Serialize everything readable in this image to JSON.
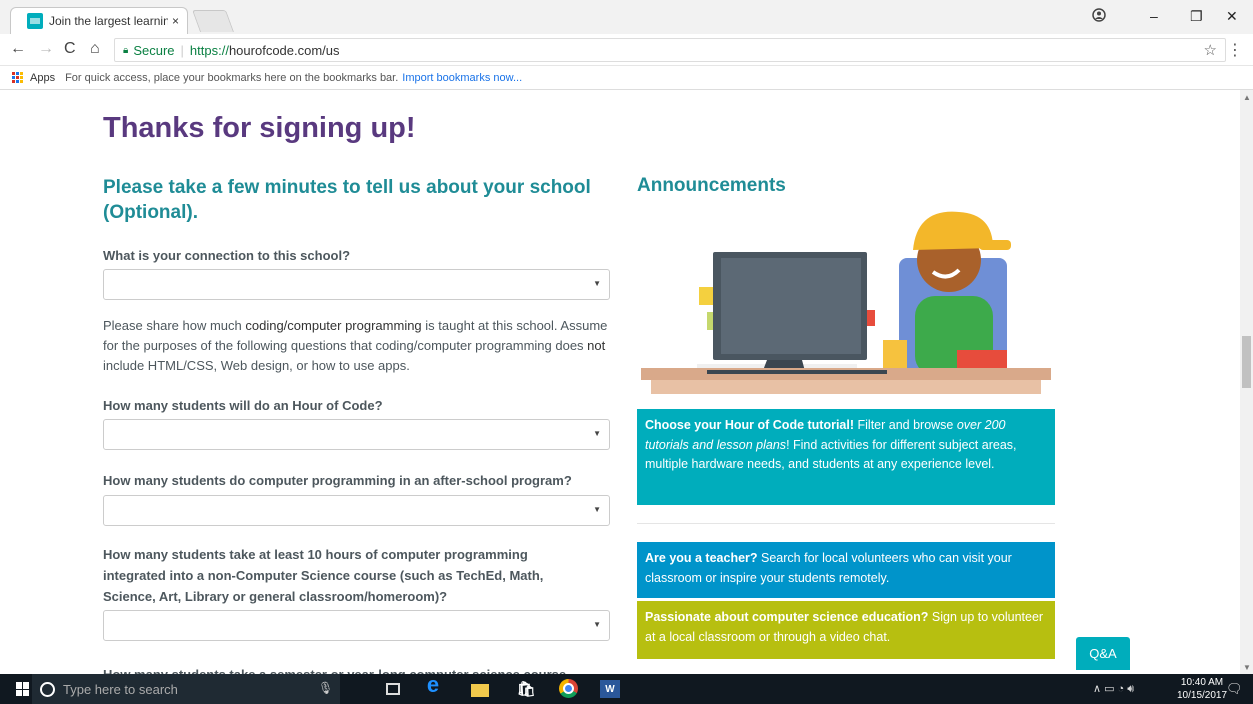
{
  "browser": {
    "tab_title": "Join the largest learning",
    "tab_close": "×",
    "profile_icon": "person-circle-icon",
    "win_minimize": "–",
    "win_restore": "❐",
    "win_close": "✕"
  },
  "toolbar": {
    "back": "←",
    "forward": "→",
    "reload": "C",
    "home": "⌂",
    "secure_label": "Secure",
    "url_scheme": "https://",
    "url_rest": "hourofcode.com/us",
    "star": "☆",
    "menu": "⋮"
  },
  "bookmarks": {
    "apps_label": "Apps",
    "hint": "For quick access, place your bookmarks here on the bookmarks bar.",
    "import_link": "Import bookmarks now..."
  },
  "page": {
    "title": "Thanks for signing up!",
    "survey_heading": "Please take a few minutes to tell us about your school (Optional).",
    "announcements_heading": "Announcements",
    "q1": "What is your connection to this school?",
    "para_before": "Please share how much ",
    "para_mid1": "coding/computer programming",
    "para_mid2": " is taught at this school. Assume for the purposes of the following questions that coding/computer programming does ",
    "para_not": "not",
    "para_end": " include HTML/CSS, Web design, or how to use apps.",
    "q2": "How many students will do an Hour of Code?",
    "q3": "How many students do computer programming in an after-school program?",
    "q4": "How many students take at least 10 hours of computer programming integrated into a non-Computer Science course (such as TechEd, Math, Science, Art, Library or general classroom/homeroom)?",
    "q5": "How many students take a semester or year-long computer science course",
    "select_caret": "▼"
  },
  "cards": {
    "teal_bold": "Choose your Hour of Code tutorial!",
    "teal_text1": " Filter and browse ",
    "teal_italic": "over 200 tutorials and lesson plans",
    "teal_text2": "! Find activities for different subject areas, multiple hardware needs, and students at any experience level.",
    "blue_bold": "Are you a teacher?",
    "blue_text": " Search for local volunteers who can visit your classroom or inspire your students remotely.",
    "green_bold": "Passionate about computer science education?",
    "green_text": " Sign up to volunteer at a local classroom or through a video chat."
  },
  "qa_button": "Q&A",
  "taskbar": {
    "search_placeholder": "Type here to search",
    "word_label": "W",
    "time": "10:40 AM",
    "date": "10/15/2017"
  },
  "colors": {
    "title": "#59397f",
    "heading": "#1f8c96",
    "teal": "#00adbc",
    "blue": "#0094ca",
    "green": "#b7bf10"
  }
}
